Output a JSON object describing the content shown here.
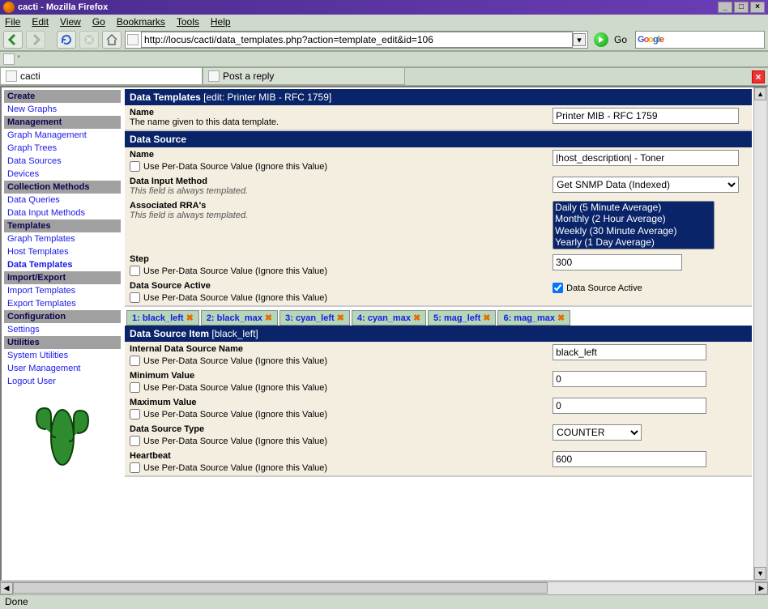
{
  "browser": {
    "title": "cacti - Mozilla Firefox",
    "menus": [
      "File",
      "Edit",
      "View",
      "Go",
      "Bookmarks",
      "Tools",
      "Help"
    ],
    "url": "http://locus/cacti/data_templates.php?action=template_edit&id=106",
    "go": "Go",
    "bookmark_item": "'",
    "tabs": [
      "cacti",
      "Post a reply"
    ],
    "status": "Done"
  },
  "sidebar": [
    {
      "type": "h",
      "label": "Create"
    },
    {
      "type": "l",
      "label": "New Graphs"
    },
    {
      "type": "h",
      "label": "Management"
    },
    {
      "type": "l",
      "label": "Graph Management"
    },
    {
      "type": "l",
      "label": "Graph Trees"
    },
    {
      "type": "l",
      "label": "Data Sources"
    },
    {
      "type": "l",
      "label": "Devices"
    },
    {
      "type": "h",
      "label": "Collection Methods"
    },
    {
      "type": "l",
      "label": "Data Queries"
    },
    {
      "type": "l",
      "label": "Data Input Methods"
    },
    {
      "type": "h",
      "label": "Templates"
    },
    {
      "type": "l",
      "label": "Graph Templates"
    },
    {
      "type": "l",
      "label": "Host Templates"
    },
    {
      "type": "l",
      "label": "Data Templates",
      "active": true
    },
    {
      "type": "h",
      "label": "Import/Export"
    },
    {
      "type": "l",
      "label": "Import Templates"
    },
    {
      "type": "l",
      "label": "Export Templates"
    },
    {
      "type": "h",
      "label": "Configuration"
    },
    {
      "type": "l",
      "label": "Settings"
    },
    {
      "type": "h",
      "label": "Utilities"
    },
    {
      "type": "l",
      "label": "System Utilities"
    },
    {
      "type": "l",
      "label": "User Management"
    },
    {
      "type": "l",
      "label": "Logout User"
    }
  ],
  "form": {
    "section1": {
      "title": "Data Templates",
      "subtitle": "[edit: Printer MIB - RFC 1759]",
      "name_label": "Name",
      "name_desc": "The name given to this data template.",
      "name_val": "Printer MIB - RFC 1759"
    },
    "section2": {
      "title": "Data Source",
      "fields": {
        "name": {
          "label": "Name",
          "value": "|host_description| - Toner"
        },
        "dim": {
          "label": "Data Input Method",
          "desc": "This field is always templated.",
          "value": "Get SNMP Data (Indexed)"
        },
        "rra": {
          "label": "Associated RRA's",
          "desc": "This field is always templated.",
          "options": [
            "Daily (5 Minute Average)",
            "Monthly (2 Hour Average)",
            "Weekly (30 Minute Average)",
            "Yearly (1 Day Average)"
          ]
        },
        "step": {
          "label": "Step",
          "value": "300"
        },
        "active": {
          "label": "Data Source Active",
          "checked": true,
          "right_label": "Data Source Active"
        }
      },
      "perds": "Use Per-Data Source Value (Ignore this Value)"
    },
    "dstabs": [
      "1: black_left",
      "2: black_max",
      "3: cyan_left",
      "4: cyan_max",
      "5: mag_left",
      "6: mag_max"
    ],
    "section3": {
      "title": "Data Source Item",
      "subtitle": "[black_left]",
      "fields": {
        "ids": {
          "label": "Internal Data Source Name",
          "value": "black_left"
        },
        "min": {
          "label": "Minimum Value",
          "value": "0"
        },
        "max": {
          "label": "Maximum Value",
          "value": "0"
        },
        "dst": {
          "label": "Data Source Type",
          "value": "COUNTER"
        },
        "hb": {
          "label": "Heartbeat",
          "value": "600"
        }
      },
      "perds": "Use Per-Data Source Value (Ignore this Value)"
    }
  }
}
